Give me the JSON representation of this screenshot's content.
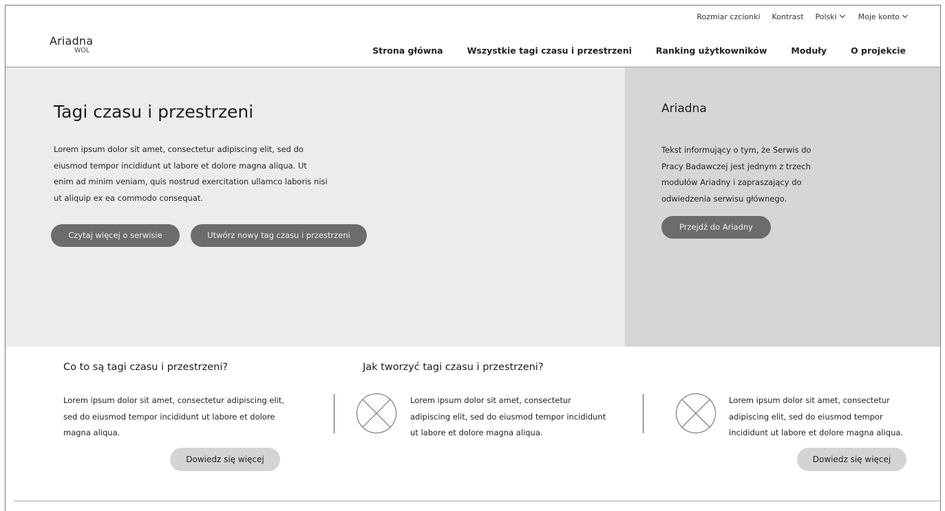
{
  "utility_bar": {
    "font_size": "Rozmiar czcionki",
    "contrast": "Kontrast",
    "language": "Polski",
    "account": "Moje konto"
  },
  "logo": {
    "name": "Ariadna",
    "sub": "WOL"
  },
  "main_nav": [
    {
      "label": "Strona główna"
    },
    {
      "label": "Wszystkie tagi czasu i przestrzeni"
    },
    {
      "label": "Ranking użytkowników"
    },
    {
      "label": "Moduły"
    },
    {
      "label": "O projekcie"
    }
  ],
  "hero": {
    "title": "Tagi czasu i przestrzeni",
    "text": "Lorem ipsum dolor sit amet, consectetur adipiscing elit, sed do eiusmod tempor incididunt ut labore et dolore magna aliqua. Ut enim ad minim veniam, quis nostrud exercitation ullamco laboris nisi ut aliquip ex ea commodo consequat.",
    "button_read_more": "Czytaj więcej o serwisie",
    "button_create": "Utwórz nowy tag czasu i przestrzeni"
  },
  "sidebar": {
    "title": "Ariadna",
    "text": "Tekst informujący o tym, że Serwis do Pracy Badawczej jest jednym z trzech modułów Ariadny i zapraszający do odwiedzenia serwisu głównego.",
    "button": "Przejdź do Ariadny"
  },
  "section_what": {
    "title": "Co to są tagi czasu i przestrzeni?",
    "text": "Lorem ipsum dolor sit amet, consectetur adipiscing elit, sed do eiusmod tempor incididunt ut labore et dolore magna aliqua.",
    "button": "Dowiedz się więcej"
  },
  "section_how": {
    "title": "Jak tworzyć tagi czasu i przestrzeni?",
    "step1_text": "Lorem ipsum dolor sit amet, consectetur adipiscing elit, sed do eiusmod tempor incididunt ut labore et dolore magna aliqua.",
    "step2_text": "Lorem ipsum dolor sit amet, consectetur adipiscing elit, sed do eiusmod tempor incididunt ut labore et dolore magna aliqua.",
    "button": "Dowiedz się więcej"
  },
  "icons": {
    "image_placeholder": "image-placeholder-icon",
    "chevron": "chevron-down-icon"
  },
  "colors": {
    "hero_bg": "#ececec",
    "sidebar_bg": "#d6d6d6",
    "button_dark": "#6c6c6c",
    "button_light": "#d4d4d4"
  }
}
